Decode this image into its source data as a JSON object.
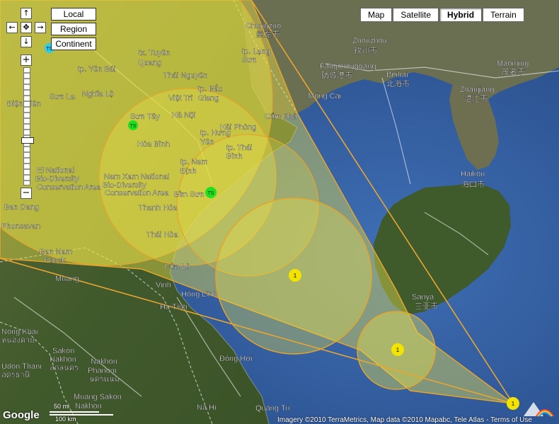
{
  "map_type": {
    "buttons": [
      "Map",
      "Satellite",
      "Hybrid",
      "Terrain"
    ],
    "active": "Hybrid"
  },
  "zoom_types": [
    "Local",
    "Region",
    "Continent"
  ],
  "pan_arrows": {
    "up": "↑",
    "down": "↓",
    "left": "←",
    "right": "→",
    "center": "✥"
  },
  "zoom": {
    "in": "+",
    "out": "−"
  },
  "places": [
    "Chongzuo",
    "崇左市",
    "tp. Lạng",
    "Sơn",
    "tx. Tuyên",
    "Quang",
    "tp. Yên Bái",
    "Thái Nguyên",
    "Nghĩa Lộ",
    "tp. Bắc",
    "Giang",
    "Việt Trì",
    "Sơn La",
    "Điện Biên",
    "Sơn Tây",
    "Hà Nội",
    "Hải Phòng",
    "Cẩm Phả",
    "Hòa Bình",
    "tp. Hưng",
    "Yên",
    "tp. Thái",
    "Bình",
    "tp. Nam",
    "Định",
    "Bỉm Sơn",
    "Thanh Hóa",
    "Thái Hòa",
    "Ban Nam",
    "Puock",
    "Muang",
    "Cửa Lò",
    "Vinh",
    "Hồng Lĩnh",
    "Hà Tĩnh",
    "Nong Khai",
    "หนองคาย",
    "Udon Thani",
    "อุดรธานี",
    "Sakon",
    "Nakhon",
    "สกลนคร",
    "Nakhon",
    "Phanom",
    "นครพนม",
    "Muang Sakon",
    "Nakhon",
    "Đồng Hới",
    "Na Hi",
    "Quảng Trị",
    "Zhouzhou",
    "钦州市",
    "Fangchenggang",
    "防城港市",
    "Beihai",
    "北海市",
    "Móng Cái",
    "Zhanjiang",
    "湛江市",
    "Maoming",
    "茂名市",
    "Haikou",
    "海口市",
    "Sanya",
    "三亚市",
    "El National",
    "Bio-Diversity",
    "Conservation Area",
    "Nam Xam National",
    "Bio-Diversity",
    "Conservation Area",
    "Ban Dang",
    "Phonsavan"
  ],
  "storm_markers": [
    {
      "label": "TS",
      "color": "#1fe01f"
    },
    {
      "label": "TS",
      "color": "#1fe01f"
    },
    {
      "label": "TS",
      "color": "#1fe01f"
    },
    {
      "label": "1",
      "color": "#f3e400"
    },
    {
      "label": "1",
      "color": "#f3e400"
    },
    {
      "label": "1",
      "color": "#f3e400"
    }
  ],
  "scale": {
    "km_label": "100 km",
    "mi_label": "50 mi"
  },
  "attribution": "Imagery ©2010 TerraMetrics, Map data ©2010 Mapabc, Tele Atlas - Terms of Use",
  "google_logo": "Google",
  "colors": {
    "land": "#4b5e2f",
    "sea": "#2e5897",
    "cone": "#ece34a",
    "cone_edge": "#e5a52a",
    "track": "#e8a630"
  }
}
